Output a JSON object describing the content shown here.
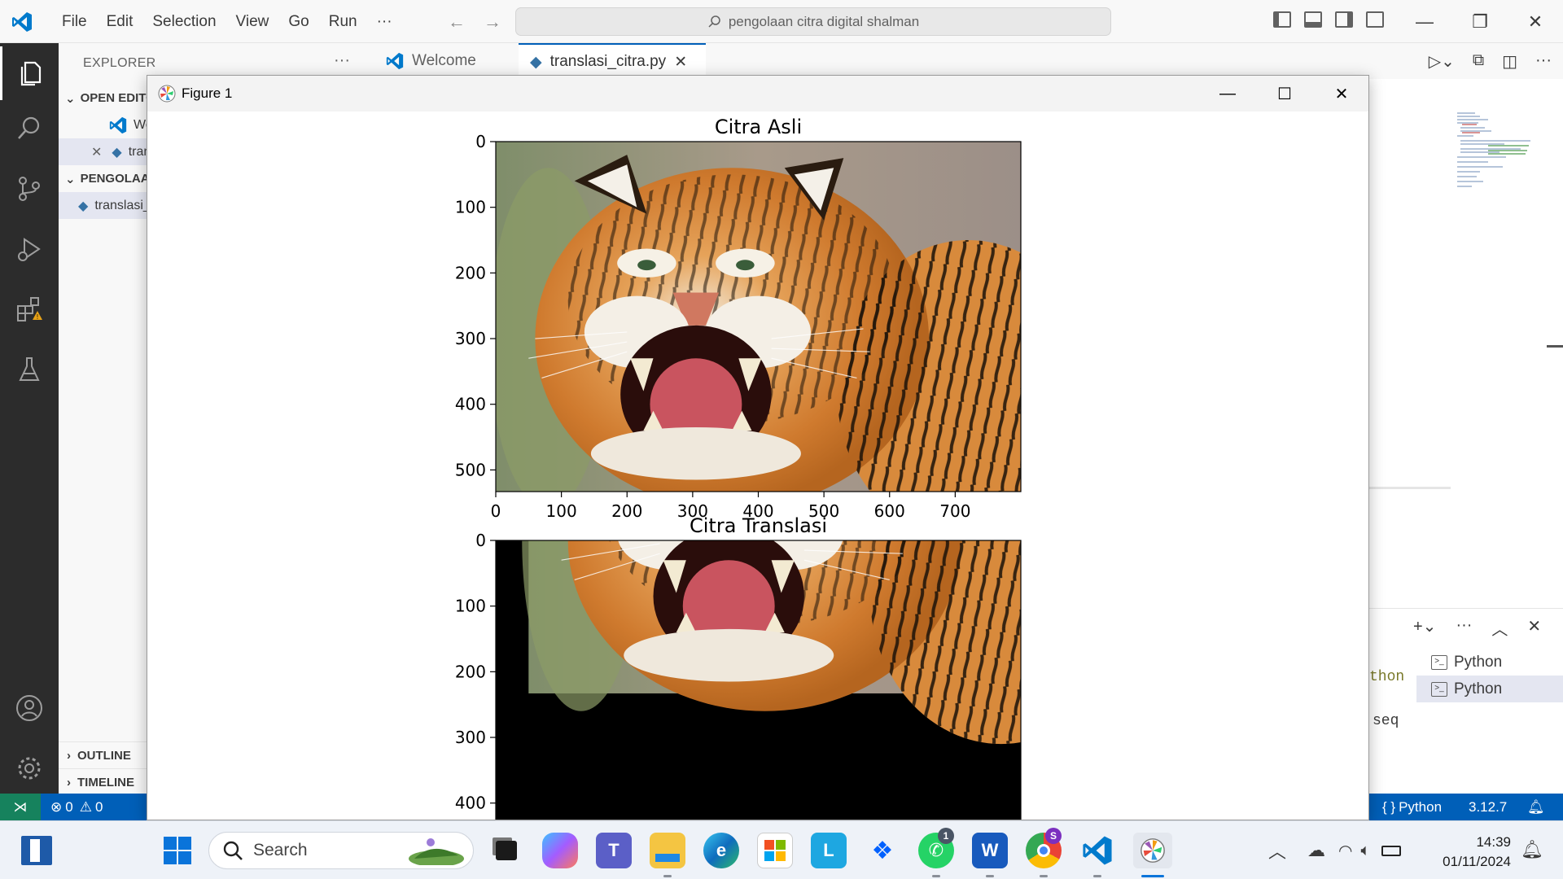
{
  "vscode": {
    "menu": [
      "File",
      "Edit",
      "Selection",
      "View",
      "Go",
      "Run",
      "···"
    ],
    "search_text": "pengolaan citra digital shalman",
    "explorer": {
      "header": "EXPLORER",
      "more": "···",
      "open_editors_label": "OPEN EDITORS",
      "open_editor_item_1": "Welcome",
      "open_editor_item_2": "translasi_citra.py",
      "folder_label": "PENGOLAAN CITRA DIGITAL SHALMAN",
      "file_item": "translasi_citra.py",
      "outline_label": "OUTLINE",
      "timeline_label": "TIMELINE"
    },
    "tabs": [
      {
        "label": "Welcome",
        "active": false
      },
      {
        "label": "translasi_citra.py",
        "active": true
      }
    ],
    "panel": {
      "terminals": [
        "Python",
        "Python"
      ],
      "text_1": "thon",
      "text_2": "seq"
    },
    "statusbar": {
      "errors": "0",
      "warnings": "0",
      "language": "Python",
      "version": "3.12.7"
    }
  },
  "figure": {
    "window_title": "Figure 1",
    "chart_data": [
      {
        "type": "image",
        "title": "Citra Asli",
        "xticks": [
          0,
          100,
          200,
          300,
          400,
          500,
          600,
          700
        ],
        "yticks": [
          0,
          100,
          200,
          300,
          400,
          500
        ],
        "xlim": [
          0,
          800
        ],
        "ylim": [
          533,
          0
        ],
        "content": "tiger photograph"
      },
      {
        "type": "image",
        "title": "Citra Translasi",
        "yticks": [
          0,
          100,
          200,
          300,
          400
        ],
        "xlim": [
          0,
          800
        ],
        "ylim": [
          533,
          0
        ],
        "content": "tiger photograph translated by (50, -300); uncovered area black"
      }
    ]
  },
  "taskbar": {
    "search_placeholder": "Search",
    "time": "14:39",
    "date": "01/11/2024",
    "whatsapp_badge": "1",
    "chrome_badge": "S"
  },
  "colors": {
    "statusbar": "#005fb8",
    "remote": "#16825d",
    "activitybar": "#2c2c2c",
    "accent": "#005fb8"
  }
}
